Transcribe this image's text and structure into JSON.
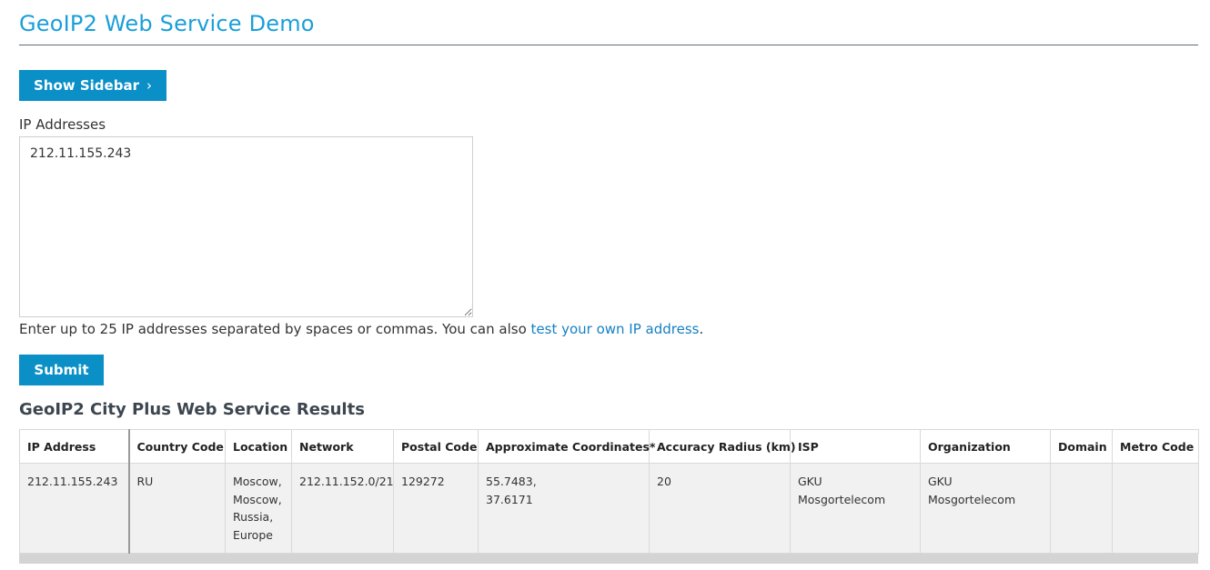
{
  "header": {
    "title": "GeoIP2 Web Service Demo"
  },
  "sidebar_toggle": {
    "label": "Show Sidebar",
    "icon": "chevron-right-icon",
    "chevron": "›"
  },
  "form": {
    "ip_label": "IP Addresses",
    "ip_value": "212.11.155.243",
    "help_prefix": "Enter up to 25 IP addresses separated by spaces or commas. You can also ",
    "help_link": "test your own IP address",
    "help_suffix": ".",
    "submit_label": "Submit"
  },
  "results": {
    "title": "GeoIP2 City Plus Web Service Results",
    "columns": [
      "IP Address",
      "Country Code",
      "Location",
      "Network",
      "Postal Code",
      "Approximate Coordinates*",
      "Accuracy Radius (km)",
      "ISP",
      "Organization",
      "Domain",
      "Metro Code"
    ],
    "rows": [
      {
        "ip": "212.11.155.243",
        "country_code": "RU",
        "location_lines": [
          "Moscow,",
          "Moscow,",
          "Russia,",
          "Europe"
        ],
        "network": "212.11.152.0/21",
        "postal_code": "129272",
        "coordinates_lines": [
          "55.7483,",
          "37.6171"
        ],
        "accuracy_radius": "20",
        "isp": "GKU Mosgortelecom",
        "organization": "GKU Mosgortelecom",
        "domain": "",
        "metro_code": ""
      }
    ]
  },
  "colors": {
    "title": "#1a9fd9",
    "button": "#0a8fc7",
    "link": "#1581c4",
    "row_bg": "#f1f1f1"
  }
}
